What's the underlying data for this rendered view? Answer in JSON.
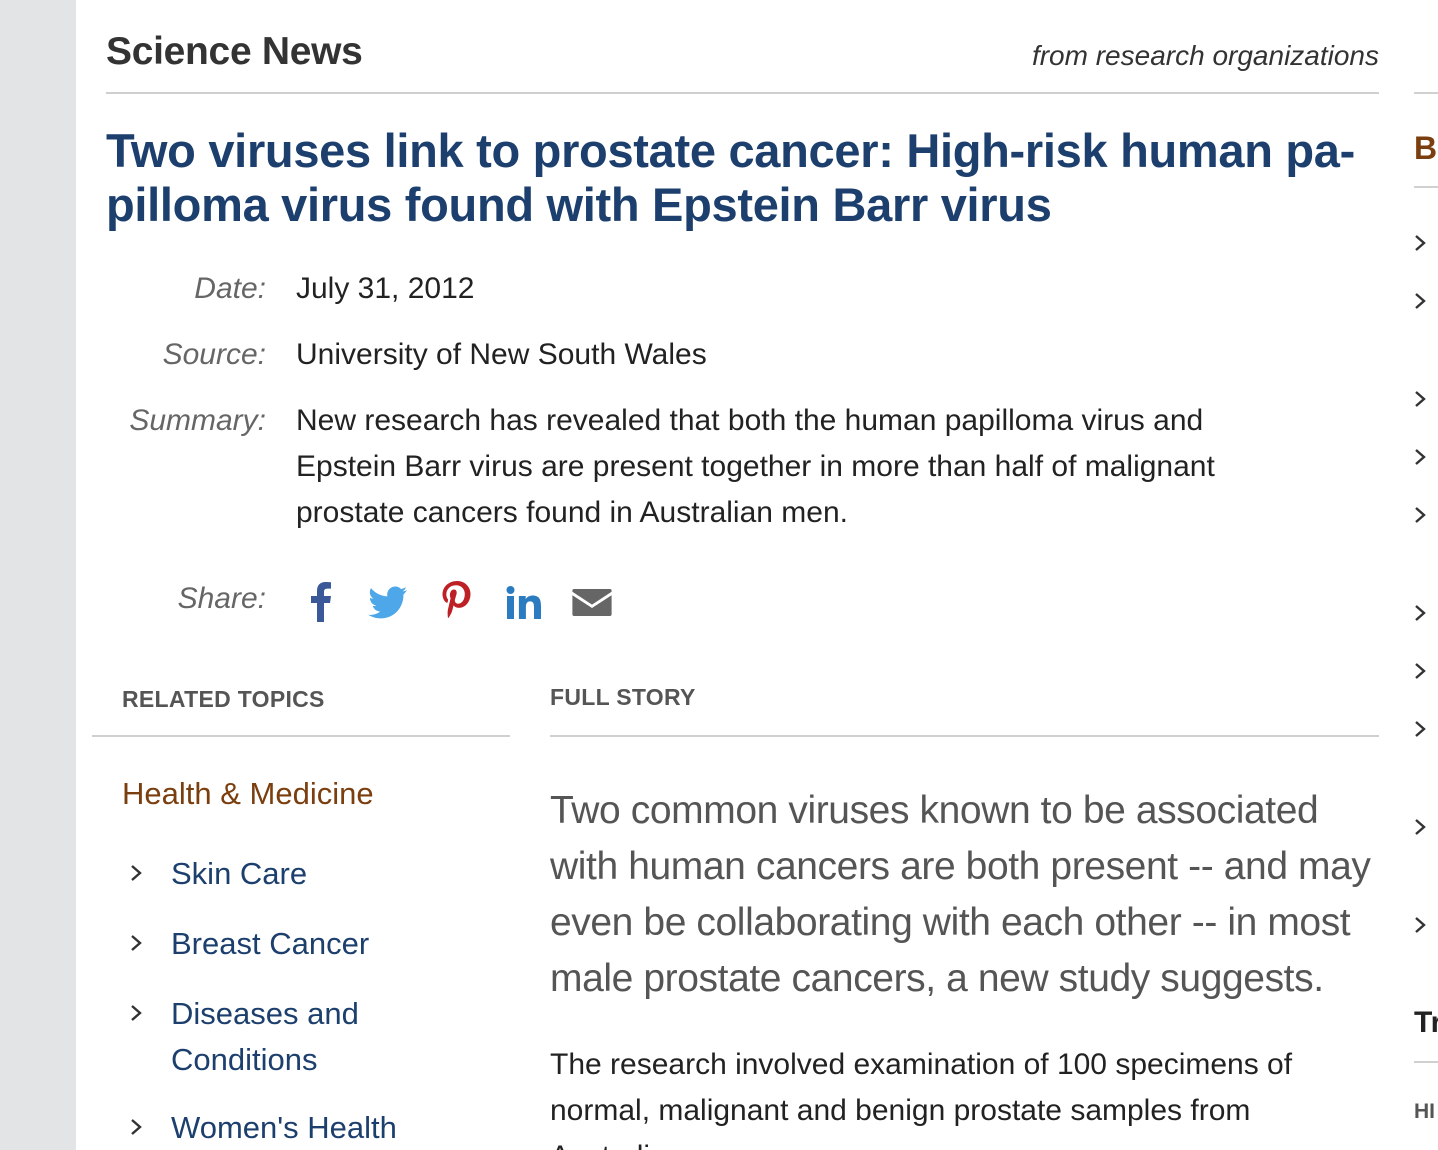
{
  "header": {
    "site_title": "Science News",
    "tagline": "from research organizations"
  },
  "article": {
    "headline": "Two viruses link to prostate cancer: High-risk human pa-pilloma virus found with Epstein Barr virus",
    "headline_line1": "Two viruses link to prostate cancer: High-risk human pa-",
    "headline_line2": "pilloma virus found with Epstein Barr virus",
    "date_label": "Date:",
    "date": "July 31, 2012",
    "source_label": "Source:",
    "source": "University of New South Wales",
    "summary_label": "Summary:",
    "summary": "New research has revealed that both the human papilloma virus and Epstein Barr virus are present together in more than half of malignant prostate cancers found in Australian men.",
    "share_label": "Share:",
    "share_icons": [
      "facebook-icon",
      "twitter-icon",
      "pinterest-icon",
      "linkedin-icon",
      "email-icon"
    ],
    "full_story_heading": "FULL STORY",
    "lede": "Two common viruses known to be associated with human cancers are both present -- and may even be collaborating with each other -- in most male prostate cancers, a new study suggests.",
    "body_first_paragraph": "The research involved examination of 100 specimens of normal, malignant and benign prostate samples from Australian men."
  },
  "related_topics": {
    "heading": "RELATED TOPICS",
    "category": "Health & Medicine",
    "items": [
      "Skin Care",
      "Breast Cancer",
      "Diseases and Conditions",
      "Women's Health"
    ]
  },
  "sidebar_peek": {
    "letter_1": "B",
    "letter_2": "Tr",
    "letter_3": "HI"
  },
  "colors": {
    "headline": "#1c3f6e",
    "category": "#7b3f0f",
    "facebook": "#3b5998",
    "twitter": "#4da7e8",
    "pinterest": "#bd2126",
    "linkedin": "#2a7bbf",
    "email": "#666666"
  }
}
